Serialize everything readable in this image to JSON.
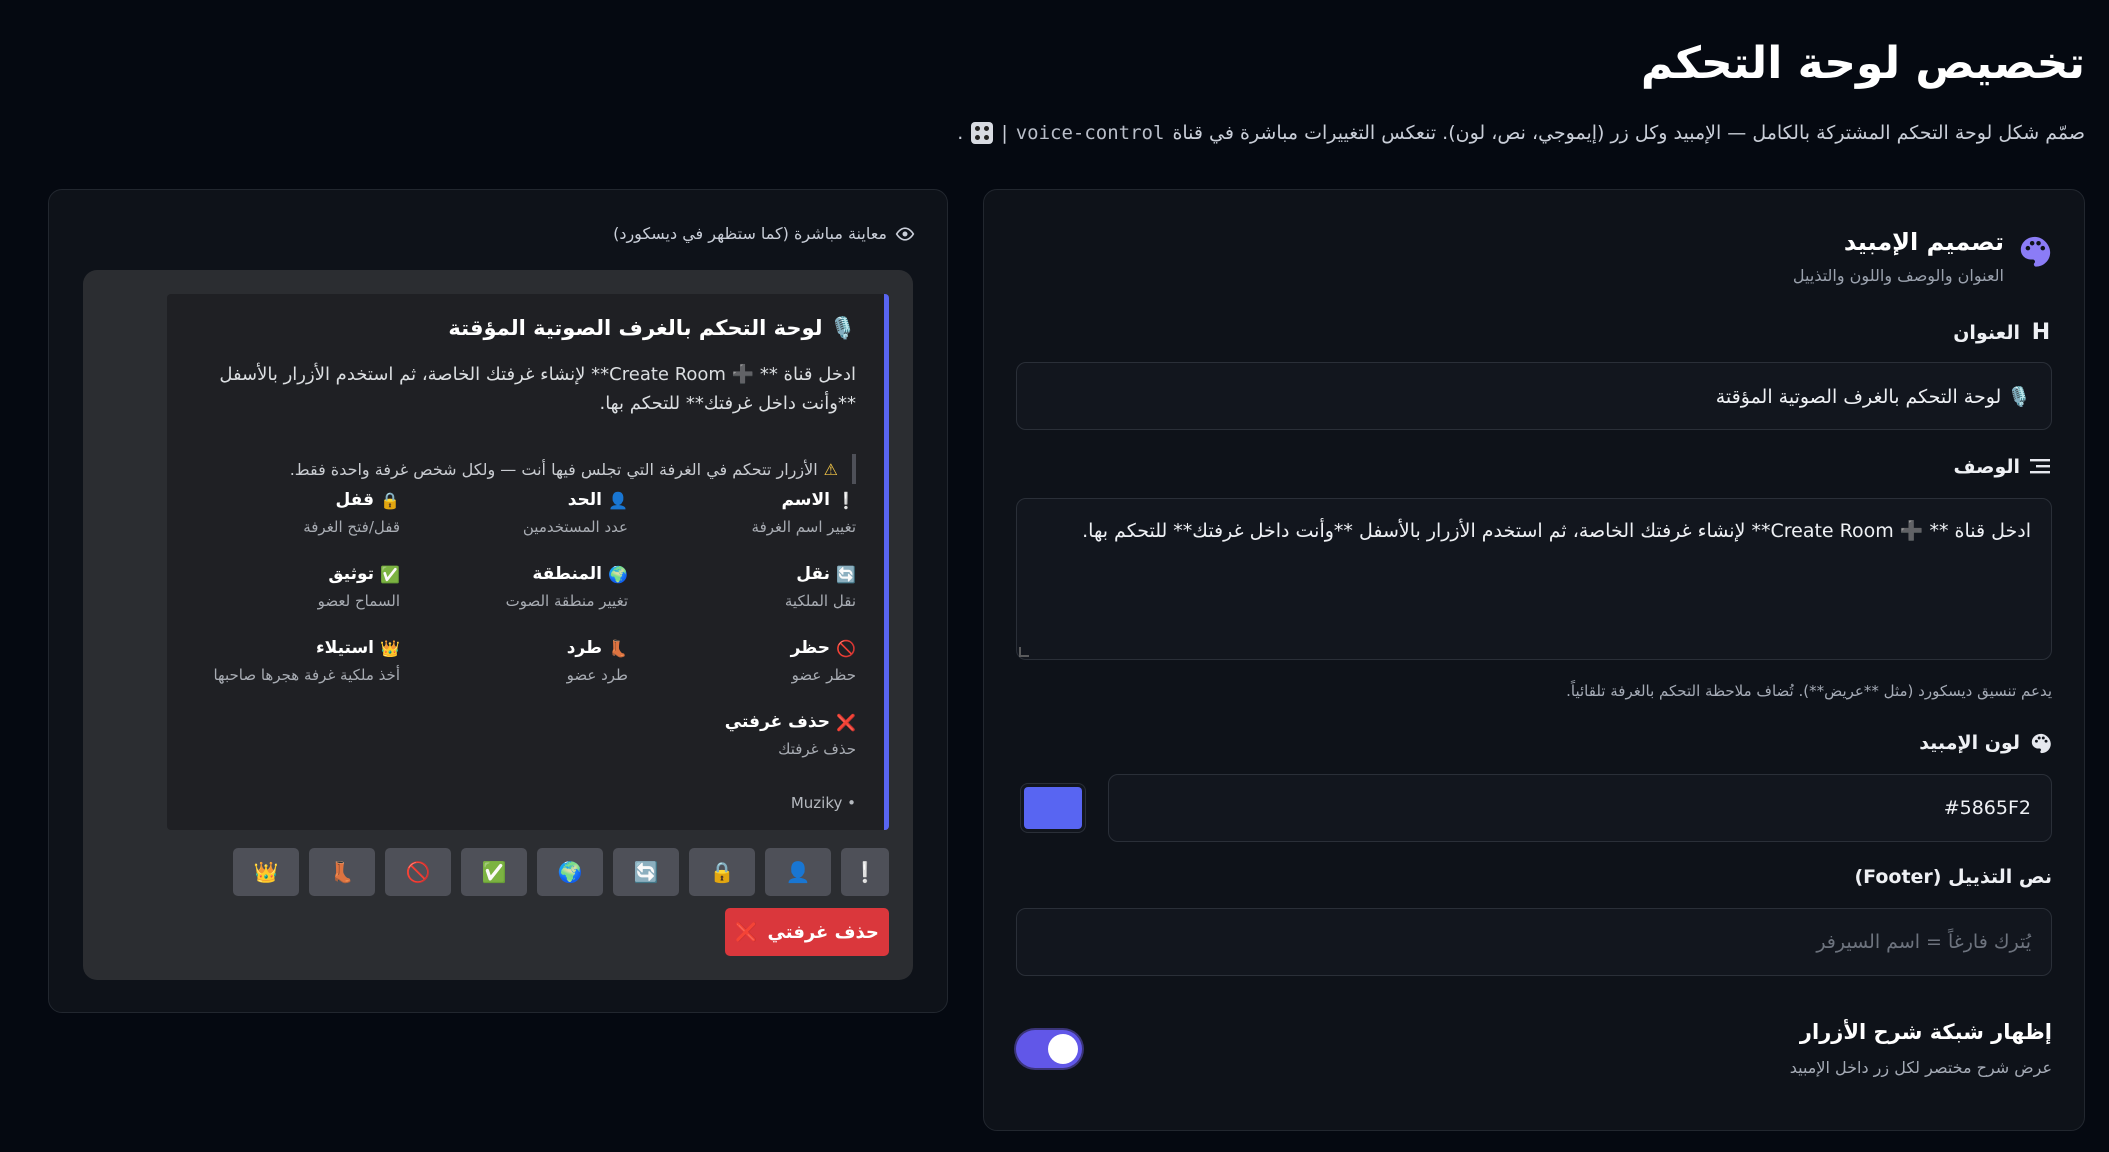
{
  "header": {
    "title": "تخصيص لوحة التحكم",
    "subtitle_before": "صمّم شكل لوحة التحكم المشتركة بالكامل — الإمبيد وكل زر (إيموجي، نص، لون). تنعكس التغييرات مباشرة في قناة",
    "channel_code": "voice-control",
    "channel_separator": "|",
    "subtitle_end": "."
  },
  "settings": {
    "section_title": "تصميم الإمبيد",
    "section_subtitle": "العنوان والوصف واللون والتذييل",
    "title_label": "العنوان",
    "title_value": "🎙️ لوحة التحكم بالغرف الصوتية المؤقتة",
    "description_label": "الوصف",
    "description_value": "ادخل قناة ** ➕ Create Room** لإنشاء غرفتك الخاصة، ثم استخدم الأزرار بالأسفل **وأنت داخل غرفتك** للتحكم بها.",
    "description_help": "يدعم تنسيق ديسكورد (مثل **عريض**). تُضاف ملاحظة التحكم بالغرفة تلقائياً.",
    "color_label": "لون الإمبيد",
    "color_value": "#5865F2",
    "footer_label": "نص التذييل (Footer)",
    "footer_placeholder": "يُترك فارغاً = اسم السيرفر",
    "toggle_title": "إظهار شبكة شرح الأزرار",
    "toggle_subtitle": "عرض شرح مختصر لكل زر داخل الإمبيد",
    "toggle_on": true
  },
  "preview": {
    "label": "معاينة مباشرة (كما ستظهر في ديسكورد)",
    "embed_color": "#5865F2",
    "embed_title": "🎙️ لوحة التحكم بالغرف الصوتية المؤقتة",
    "embed_desc_line1": "ادخل قناة ** ➕ Create Room** لإنشاء غرفتك الخاصة، ثم استخدم الأزرار بالأسفل",
    "embed_desc_line2": "**وأنت داخل غرفتك** للتحكم بها.",
    "quote": "الأزرار تتحكم في الغرفة التي تجلس فيها أنت — ولكل شخص غرفة واحدة فقط.",
    "grid": [
      {
        "emoji": "❕",
        "name": "الاسم",
        "desc": "تغيير اسم الغرفة"
      },
      {
        "emoji": "👤",
        "name": "الحد",
        "desc": "عدد المستخدمين"
      },
      {
        "emoji": "🔒",
        "name": "قفل",
        "desc": "قفل/فتح الغرفة"
      },
      {
        "emoji": "🔄",
        "name": "نقل",
        "desc": "نقل الملكية"
      },
      {
        "emoji": "🌍",
        "name": "المنطقة",
        "desc": "تغيير منطقة الصوت"
      },
      {
        "emoji": "✅",
        "name": "توثيق",
        "desc": "السماح لعضو"
      },
      {
        "emoji": "🚫",
        "name": "حظر",
        "desc": "حظر عضو"
      },
      {
        "emoji": "👢",
        "name": "طرد",
        "desc": "طرد عضو"
      },
      {
        "emoji": "👑",
        "name": "استيلاء",
        "desc": "أخذ ملكية غرفة هجرها صاحبها"
      },
      {
        "emoji": "❌",
        "name": "حذف غرفتي",
        "desc": "حذف غرفتك"
      }
    ],
    "footer": "• Muziky",
    "buttons": [
      "❕",
      "👤",
      "🔒",
      "🔄",
      "🌍",
      "✅",
      "🚫",
      "👢",
      "👑"
    ],
    "delete_button_label": "حذف غرفتي",
    "delete_button_icon": "❌"
  }
}
